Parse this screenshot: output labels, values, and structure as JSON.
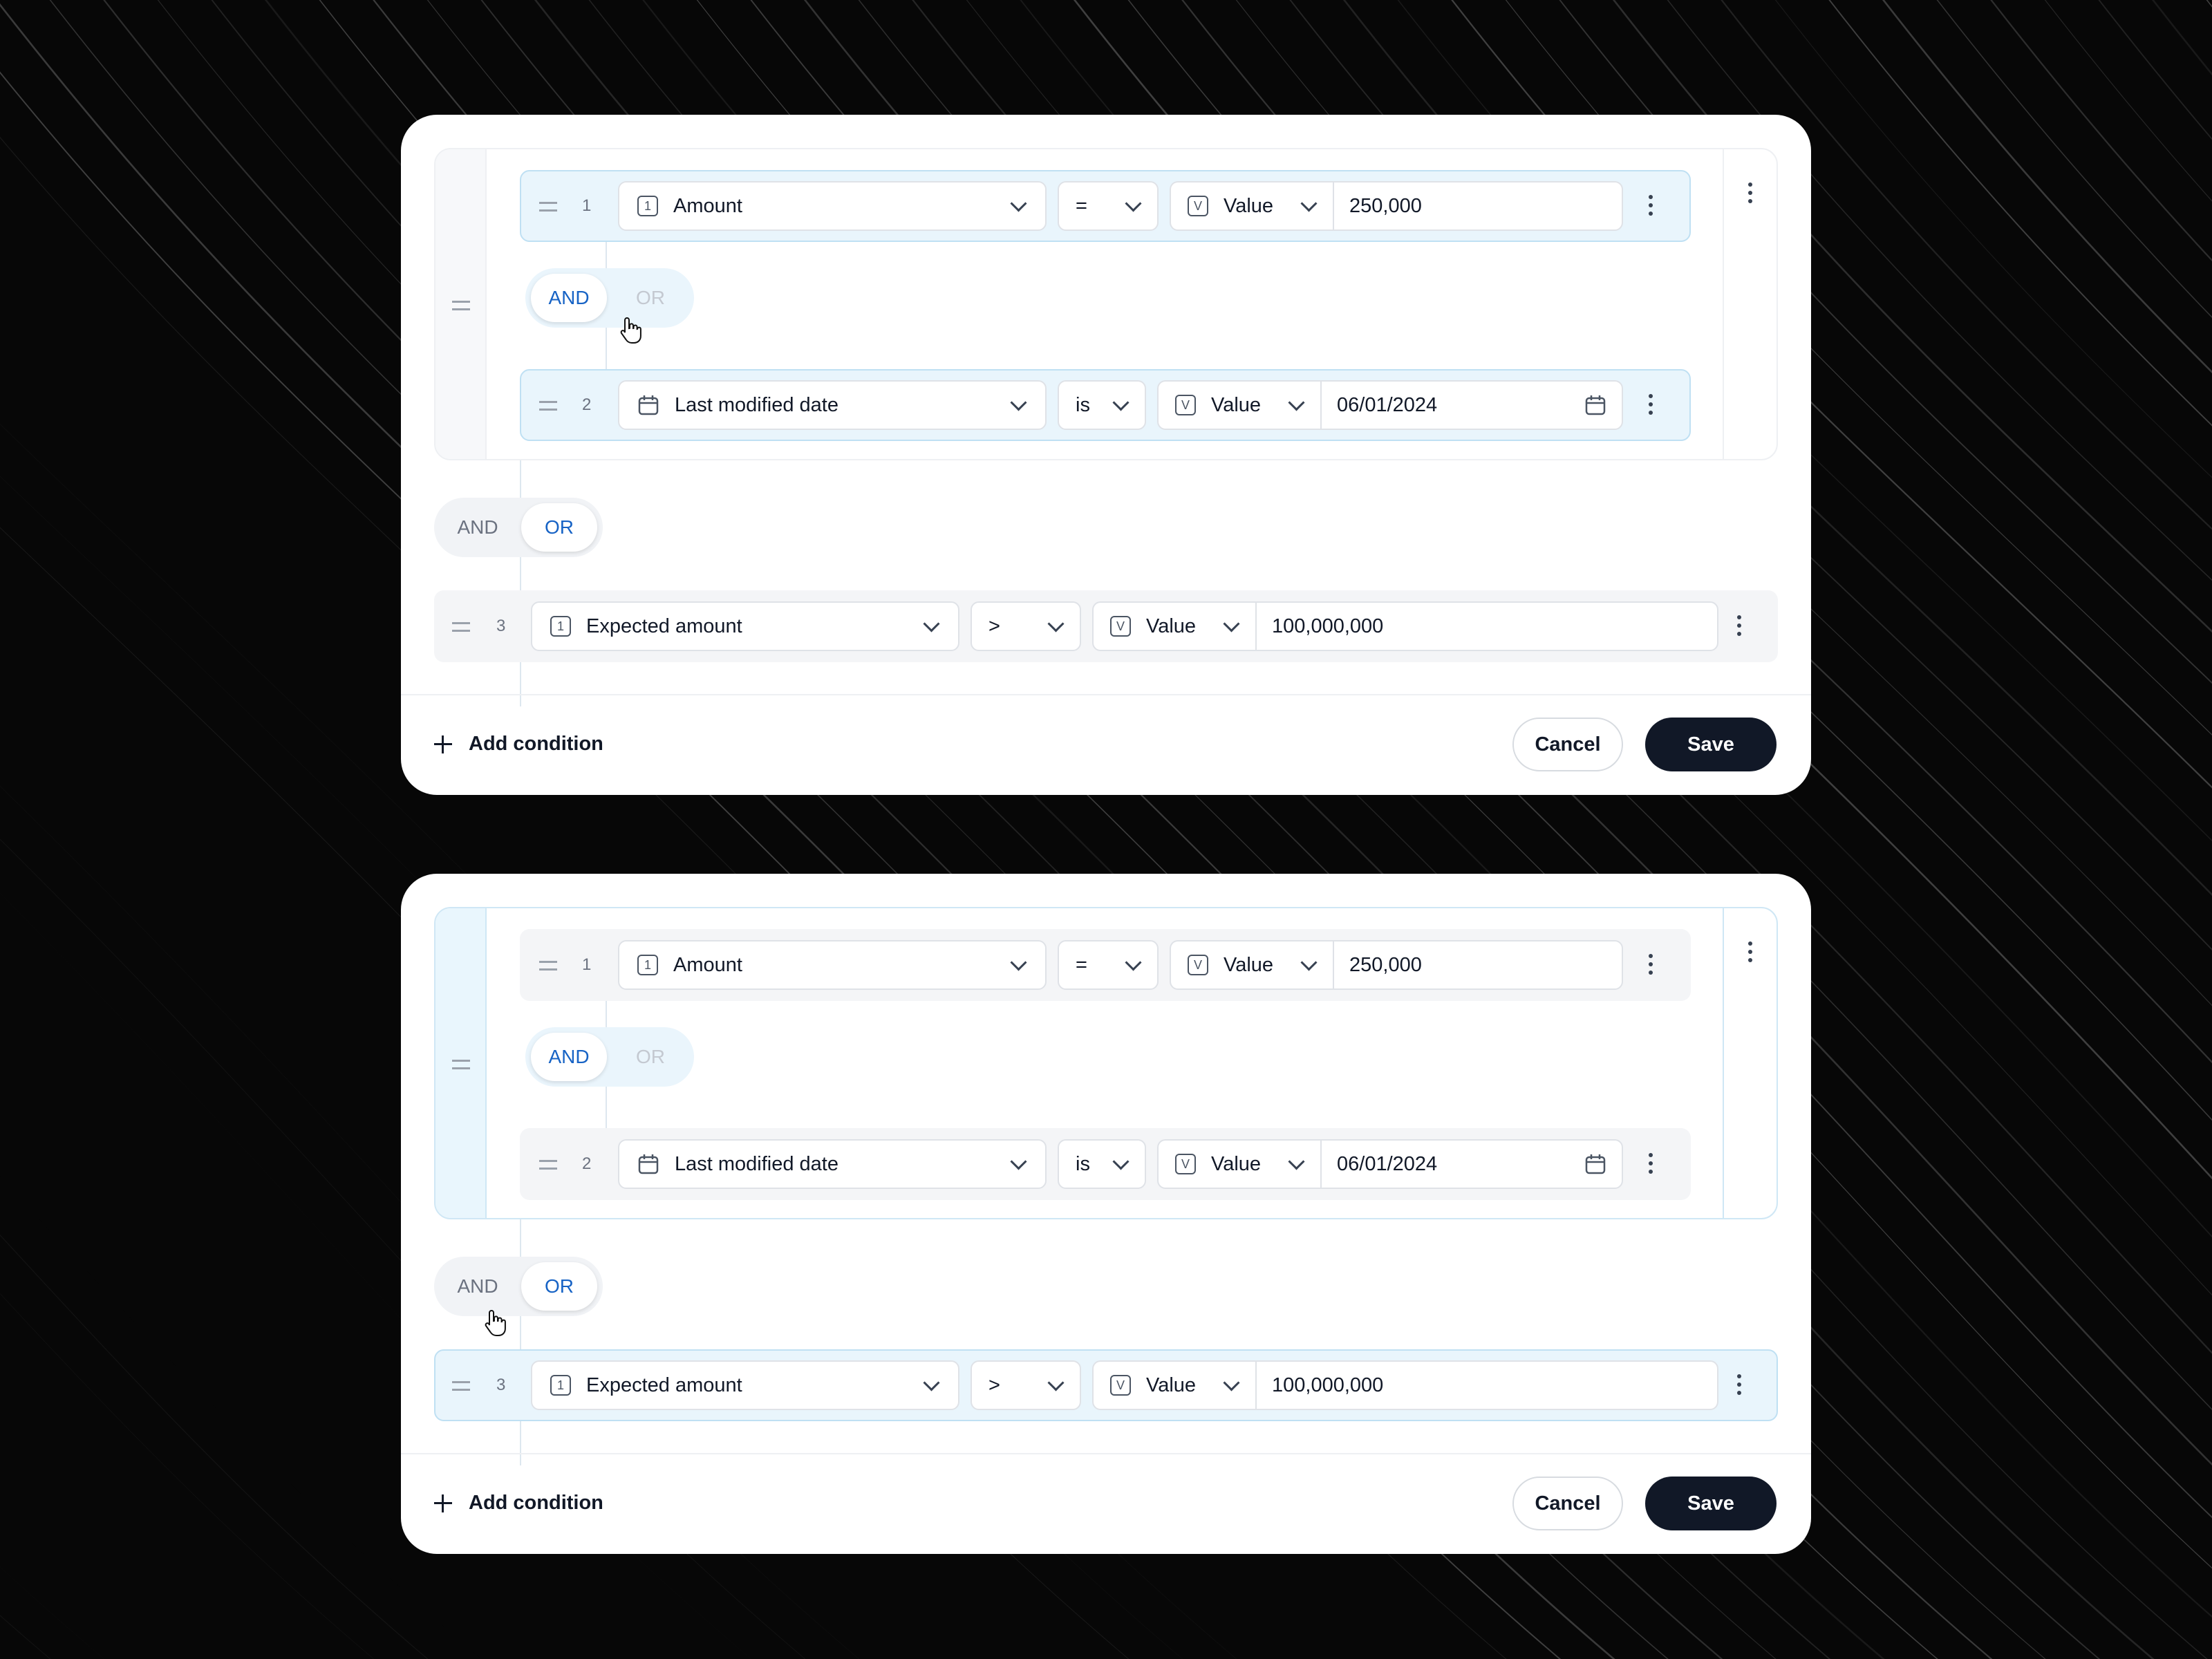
{
  "panels": [
    {
      "group": {
        "rows": [
          {
            "num": "1",
            "field": "Amount",
            "field_icon": "number-icon",
            "op": "=",
            "value_type": "Value",
            "value": "250,000",
            "selected": true
          },
          {
            "num": "2",
            "field": "Last modified date",
            "field_icon": "calendar-icon",
            "op": "is",
            "value_type": "Value",
            "value": "06/01/2024",
            "selected": true
          }
        ],
        "joiner": {
          "and": "AND",
          "or": "OR",
          "active": "AND"
        }
      },
      "outer_joiner": {
        "and": "AND",
        "or": "OR",
        "active": "OR"
      },
      "row3": {
        "num": "3",
        "field": "Expected amount",
        "op": ">",
        "value_type": "Value",
        "value": "100,000,000"
      },
      "footer": {
        "add": "Add condition",
        "cancel": "Cancel",
        "save": "Save"
      }
    },
    {
      "group": {
        "rows": [
          {
            "num": "1",
            "field": "Amount",
            "field_icon": "number-icon",
            "op": "=",
            "value_type": "Value",
            "value": "250,000",
            "selected": false
          },
          {
            "num": "2",
            "field": "Last modified date",
            "field_icon": "calendar-icon",
            "op": "is",
            "value_type": "Value",
            "value": "06/01/2024",
            "selected": false
          }
        ],
        "joiner": {
          "and": "AND",
          "or": "OR",
          "active": "AND"
        }
      },
      "outer_joiner": {
        "and": "AND",
        "or": "OR",
        "active": "OR"
      },
      "row3": {
        "num": "3",
        "field": "Expected amount",
        "op": ">",
        "value_type": "Value",
        "value": "100,000,000"
      },
      "footer": {
        "add": "Add condition",
        "cancel": "Cancel",
        "save": "Save"
      }
    }
  ],
  "icons": {
    "number_glyph": "1",
    "value_glyph": "V"
  },
  "colors": {
    "active_toggle_text": "#1763c5",
    "selected_row_bg": "#e9f5fc",
    "save_button_bg": "#111827"
  }
}
